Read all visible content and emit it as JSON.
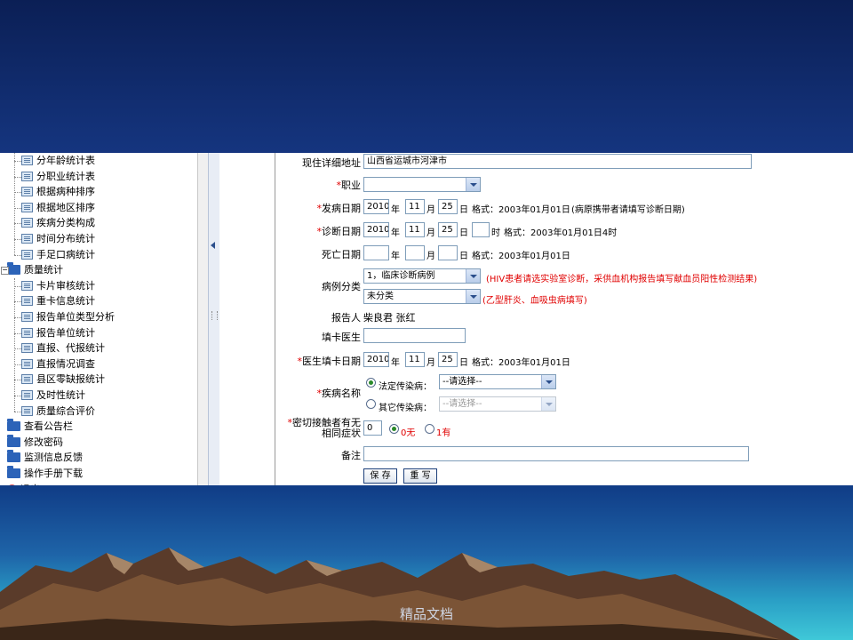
{
  "tree": {
    "items": [
      {
        "label": "分年龄统计表",
        "type": "doc"
      },
      {
        "label": "分职业统计表",
        "type": "doc"
      },
      {
        "label": "根据病种排序",
        "type": "doc"
      },
      {
        "label": "根据地区排序",
        "type": "doc"
      },
      {
        "label": "疾病分类构成",
        "type": "doc"
      },
      {
        "label": "时间分布统计",
        "type": "doc"
      },
      {
        "label": "手足口病统计",
        "type": "doc"
      },
      {
        "label": "质量统计",
        "type": "folder"
      },
      {
        "label": "卡片审核统计",
        "type": "doc"
      },
      {
        "label": "重卡信息统计",
        "type": "doc"
      },
      {
        "label": "报告单位类型分析",
        "type": "doc"
      },
      {
        "label": "报告单位统计",
        "type": "doc"
      },
      {
        "label": "直报、代报统计",
        "type": "doc"
      },
      {
        "label": "直报情况调查",
        "type": "doc"
      },
      {
        "label": "县区零缺报统计",
        "type": "doc"
      },
      {
        "label": "及时性统计",
        "type": "doc"
      },
      {
        "label": "质量综合评价",
        "type": "doc"
      },
      {
        "label": "查看公告栏",
        "type": "folder"
      },
      {
        "label": "修改密码",
        "type": "folder"
      },
      {
        "label": "监测信息反馈",
        "type": "folder"
      },
      {
        "label": "操作手册下载",
        "type": "folder"
      },
      {
        "label": "退出",
        "type": "exit"
      }
    ]
  },
  "form": {
    "address": {
      "label": "现住详细地址",
      "value": "山西省运城市河津市"
    },
    "occupation": {
      "label": "职业",
      "value": ""
    },
    "onset": {
      "label": "发病日期",
      "year": "2010",
      "month": "11",
      "day": "25",
      "u_year": "年",
      "u_month": "月",
      "u_day": "日",
      "hint": "格式：2003年01月01日",
      "note": "(病原携带者请填写诊断日期)"
    },
    "diagnosis": {
      "label": "诊断日期",
      "year": "2010",
      "month": "11",
      "day": "25",
      "hour": "",
      "u_year": "年",
      "u_month": "月",
      "u_day": "日",
      "u_hour": "时",
      "hint": "格式：2003年01月01日4时"
    },
    "death": {
      "label": "死亡日期",
      "year": "",
      "month": "",
      "day": "",
      "u_year": "年",
      "u_month": "月",
      "u_day": "日",
      "hint": "格式：2003年01月01日"
    },
    "case_class": {
      "label": "病例分类",
      "value1": "1，临床诊断病例",
      "note1": "(HIV患者请选实验室诊断，采供血机构报告填写献血员阳性检测结果)",
      "value2": "未分类",
      "note2": "(乙型肝炎、血吸虫病填写)"
    },
    "reporter": {
      "label": "报告人",
      "value": "柴良君 张红"
    },
    "doctor": {
      "label": "填卡医生",
      "value": ""
    },
    "fill_date": {
      "label": "医生填卡日期",
      "year": "2010",
      "month": "11",
      "day": "25",
      "u_year": "年",
      "u_month": "月",
      "u_day": "日",
      "hint": "格式：2003年01月01日"
    },
    "disease": {
      "label": "疾病名称",
      "legal_label": "法定传染病：",
      "legal_value": "--请选择--",
      "other_label": "其它传染病：",
      "other_value": "--请选择--"
    },
    "contact": {
      "label_line1": "密切接触者有无",
      "label_line2": "相同症状",
      "value": "0",
      "opt_no": "0无",
      "opt_yes": "1有"
    },
    "remark": {
      "label": "备注",
      "value": ""
    },
    "buttons": {
      "save": "保 存",
      "reset": "重 写"
    }
  },
  "footer": {
    "watermark": "精品文档"
  },
  "colors": {
    "required": "#e00000",
    "field_border": "#7f9db9",
    "slide_bg": "#0d2a6b"
  }
}
